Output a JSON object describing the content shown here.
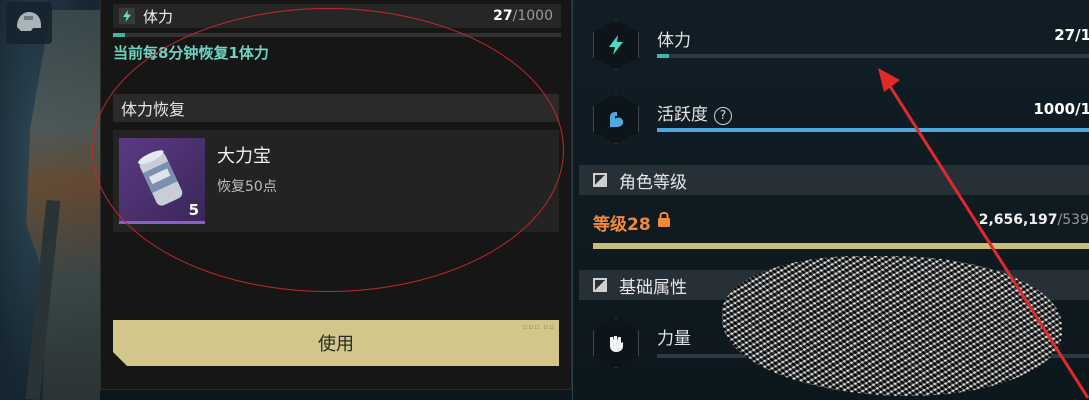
{
  "colors": {
    "accent_teal": "#3fb4a8",
    "regen_text": "#6fd3c2",
    "use_button": "#d2c68a",
    "level_orange": "#f08a3a",
    "activity_bar": "#4fa9e0",
    "annotation_red": "#c0292e",
    "item_rarity_purple": "#5b3a84"
  },
  "top_left": {
    "icon": "helmet-icon"
  },
  "stamina_popup": {
    "title": "体力",
    "current": "27",
    "max": "/1000",
    "fill_fraction": 0.027,
    "regen_text": "当前每8分钟恢复1体力",
    "section_title": "体力恢复",
    "item": {
      "name": "大力宝",
      "desc": "恢复50点",
      "qty": "5",
      "icon": "can-icon"
    },
    "use_label": "使用"
  },
  "right_panel": {
    "stamina": {
      "label": "体力",
      "value": "27/1",
      "icon": "bolt-icon",
      "fill_fraction": 0.027
    },
    "activity": {
      "label": "活跃度",
      "help": "?",
      "value": "1000/1",
      "icon": "flex-arm-icon",
      "fill_fraction": 1.0
    },
    "level_section": {
      "title": "角色等级"
    },
    "level": {
      "label": "等级28",
      "exp": "2,656,197",
      "exp_max": "/539",
      "fill_fraction": 1.0
    },
    "attr_section": {
      "title": "基础属性"
    },
    "power": {
      "label": "力量",
      "icon": "fist-icon"
    }
  }
}
